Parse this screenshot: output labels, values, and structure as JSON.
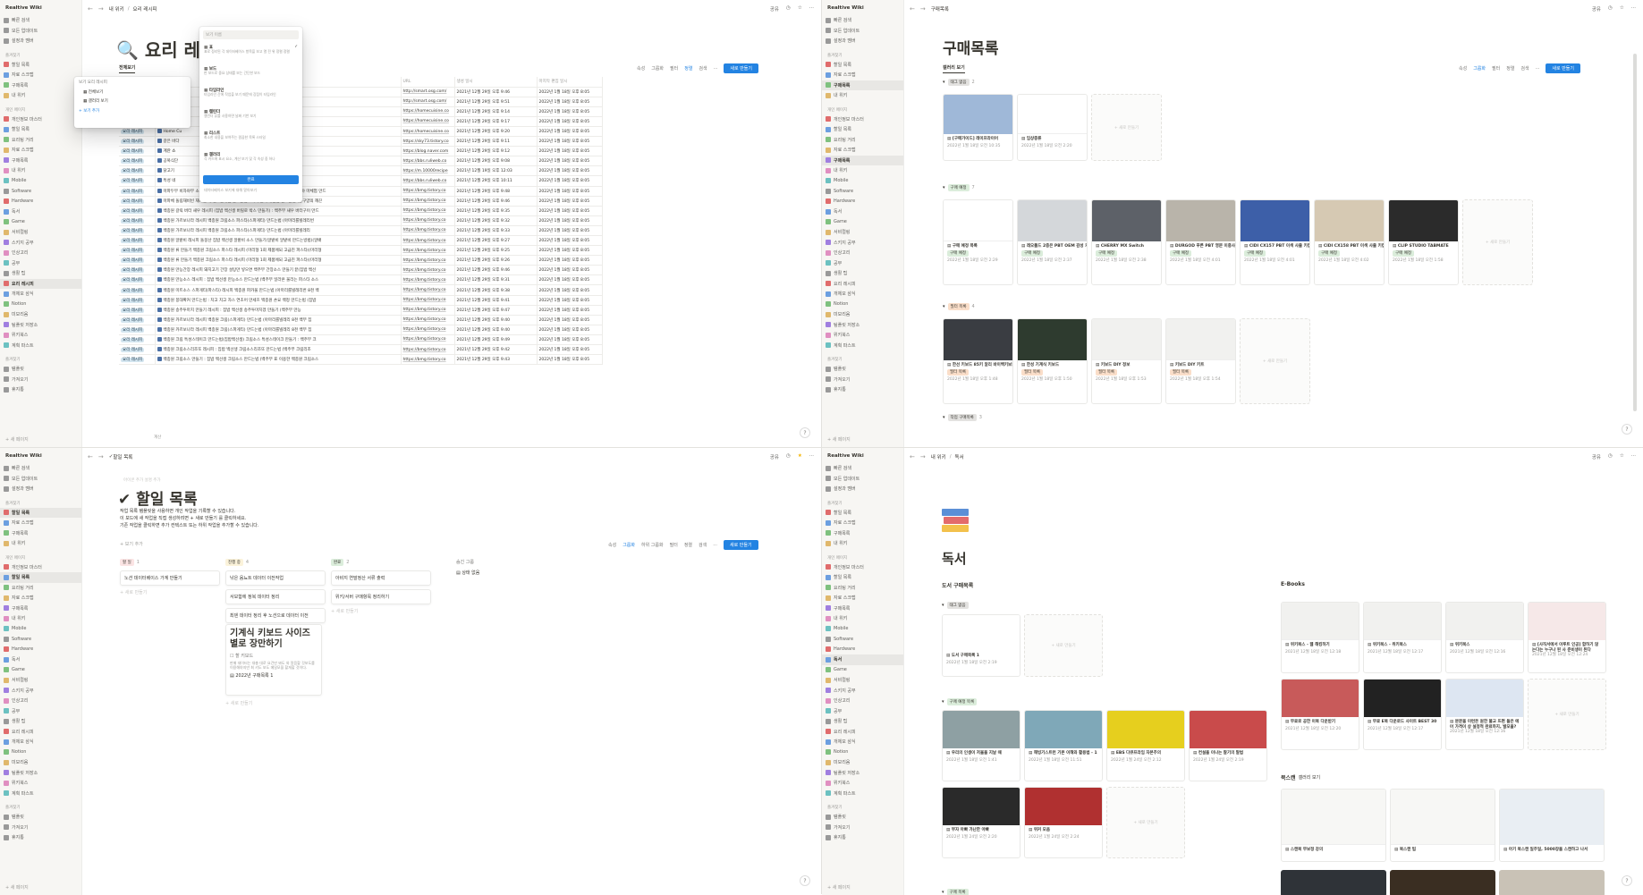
{
  "workspace": "Realtive Wiki",
  "sidebar": {
    "top_items": [
      "빠른 검색",
      "모든 업데이트",
      "설정과 멤버"
    ],
    "favorites_title": "즐겨찾기",
    "favorites": [
      "할일 목록",
      "자료 스크랩",
      "구매목록",
      "내 위키"
    ],
    "private_title": "개인 페이지",
    "private": [
      "개인정보 마스터",
      "할일 목록",
      "요리팅 거리",
      "자료 스크랩",
      "구매목록",
      "내 위키",
      "Mobile",
      "Software",
      "Hardware",
      "독서",
      "Game",
      "서비컬링",
      "스키지 공부",
      "인상고리",
      "공부",
      "생활 팁",
      "요리 레시피",
      "개체모 삼식",
      "Notion",
      "미모리움",
      "팀플릿 저장소",
      "위키북스",
      "계획 파스트"
    ],
    "bottom_items": [
      "템플릿",
      "가져오기",
      "휴지통"
    ],
    "new_page": "+ 새 페이지"
  },
  "q1": {
    "breadcrumb": [
      "내 위키",
      "요리 레시피"
    ],
    "top_right": [
      "공유",
      "◷",
      "☆",
      "···"
    ],
    "title": "요리 레시",
    "view_label": "전체보기",
    "toolbar": [
      "속성",
      "그룹화",
      "필터",
      "정렬",
      "검색",
      "···"
    ],
    "new_button": "새로 만들기",
    "view_popup": {
      "header": "보기 요리 레시피",
      "items": [
        "전체보기",
        "갤러리 보기"
      ],
      "add": "+ 보기 추가"
    },
    "layout_popup": {
      "search": "보기 이름",
      "options": [
        {
          "name": "표",
          "desc": "표로 정리된 각 데이터베이스 항목을 보고 열 전 위 정렬 정렬"
        },
        {
          "name": "보드",
          "desc": "판 보드로 중요 상태를 보는 간단한 보드"
        },
        {
          "name": "타임라인",
          "desc": "타임라인 간에 작업을 보기 때문에 장점이 타임라인"
        },
        {
          "name": "캘린더",
          "desc": "캘린더 뷰를 사용하면 날짜 기반 보기"
        },
        {
          "name": "리스트",
          "desc": "최소한 내용을 보여주는 깔끔한 목록 스타일"
        },
        {
          "name": "갤러리",
          "desc": "각 카드에 표시 요소, 계산 보기 및 각 속성 중 하나"
        }
      ],
      "done": "완료",
      "hint": "데이터베이스 보기에 대해 알아보기"
    },
    "columns": [
      "태그",
      "Aa 이름",
      "URL",
      "생성 일시",
      "마지막 편집 일시"
    ],
    "rows": [
      {
        "tag": "",
        "name": "",
        "url": "http://smart.osg.com/",
        "created": "2021년 12월 29일 오후 9:46",
        "edited": "2022년 1월 18일 오후 8:05"
      },
      {
        "tag": "",
        "name": "",
        "url": "http://smart.osg.com/",
        "created": "2021년 12월 29일 오후 9:51",
        "edited": "2022년 1월 18일 오후 8:05"
      },
      {
        "tag": "",
        "name": "",
        "url": "https://homecuisine.co",
        "created": "2021년 12월 29일 오후 9:14",
        "edited": "2022년 1월 18일 오후 8:05"
      },
      {
        "tag": "요리 레시피",
        "name": "Home Cu",
        "url": "https://homecuisine.co",
        "created": "2021년 12월 29일 오후 9:17",
        "edited": "2022년 1월 18일 오후 8:05"
      },
      {
        "tag": "요리 레시피",
        "name": "Home Cu",
        "url": "https://homecuisine.co",
        "created": "2021년 12월 29일 오후 9:20",
        "edited": "2022년 1월 18일 오후 8:05"
      },
      {
        "tag": "요리 레시피",
        "name": "갈은 바다",
        "url": "https://sky73.tistory.co",
        "created": "2021년 12월 29일 오후 9:11",
        "edited": "2022년 1월 18일 오후 8:05"
      },
      {
        "tag": "요리 레시피",
        "name": "계란 쇼",
        "url": "https://blog.naver.com",
        "created": "2021년 12월 29일 오후 9:12",
        "edited": "2022년 1월 18일 오후 8:05"
      },
      {
        "tag": "요리 레시피",
        "name": "공복식단",
        "url": "https://bbs.ruliweb.co",
        "created": "2021년 12월 29일 오후 9:08",
        "edited": "2022년 1월 18일 오후 8:05"
      },
      {
        "tag": "요리 레시피",
        "name": "닭고기",
        "url": "https://m.10000recipe",
        "created": "2021년 12월 19일 오후 12:03",
        "edited": "2022년 1월 18일 오후 8:05"
      },
      {
        "tag": "요리 레시피",
        "name": "특성 네",
        "url": "https://bbs.ruliweb.co",
        "created": "2021년 12월 29일 오후 10:11",
        "edited": "2022년 1월 18일 오후 8:05"
      },
      {
        "tag": "요리 레시피",
        "name": "마파두부 비자야부 소스 만드는법 - 마파리 를멜레비비 마파두 마소스 파니지 (비자야 마체험 만드",
        "url": "https://bmg.tistory.co",
        "created": "2021년 12월 29일 오후 9:48",
        "edited": "2022년 1월 18일 오후 8:05"
      },
      {
        "tag": "요리 레시피",
        "name": "마파체 돌림재비빈 재비빔 채 일로불볶음 만드는법 : 마파 만화 볶음밥 만드는법 (한구양의 깨끈",
        "url": "https://bmg.tistory.co",
        "created": "2021년 12월 29일 오후 9:46",
        "edited": "2022년 1월 18일 오후 8:05"
      },
      {
        "tag": "요리 레시피",
        "name": "백종원 갈릭 버터 새우 레시피 (집밥 백선생 버릴로 박스 만들기) : 백주부 새우 버터구이 만드",
        "url": "https://bmg.tistory.co",
        "created": "2021년 12월 29일 오후 9:35",
        "edited": "2022년 1월 18일 오후 8:05"
      },
      {
        "tag": "요리 레시피",
        "name": "백종원 가르보나라 레시피 백종원 크림소스 파스타(스파게티) 만드는법 (아마리를빌레리번 ",
        "url": "https://bmg.tistory.co",
        "created": "2021년 12월 29일 오후 9:32",
        "edited": "2022년 1월 18일 오후 8:05"
      },
      {
        "tag": "요리 레시피",
        "name": "백종원 가르보나라 레시피 백종원 크림소스 파스타(스파게티) 만드는법 (아마리를빌레리",
        "url": "https://bmg.tistory.co",
        "created": "2021년 12월 29일 오후 9:33",
        "edited": "2022년 1월 18일 오후 8:05"
      },
      {
        "tag": "요리 레시피",
        "name": "백종원 알밭비 레시피 돌뭉산 집밥 백선생 알밭비 소스 만들기(알밭비 알밭비 만드는방법)(알배",
        "url": "https://bmg.tistory.co",
        "created": "2021년 12월 29일 오후 9:27",
        "edited": "2022년 1월 18일 오후 8:05"
      },
      {
        "tag": "요리 레시피",
        "name": "백종원 류 만들기 백종원 크림소스 파스타 레시피 (마리형 1회 제품에되 고급진 파스타)(마리형",
        "url": "https://bmg.tistory.co",
        "created": "2021년 12월 29일 오후 9:25",
        "edited": "2022년 1월 18일 오후 8:05"
      },
      {
        "tag": "요리 레시피",
        "name": "백종원 류 만들기 백종원 크림소스 파스타 레시피 (마리형 1회 제품에되 고급진 파스타)(마리형",
        "url": "https://bmg.tistory.co",
        "created": "2021년 12월 29일 오후 9:26",
        "edited": "2022년 1월 18일 오후 8:05"
      },
      {
        "tag": "요리 레시피",
        "name": "백종원 만능간장 레시피 돼지고기 간장 설탕만 넣으면 백주부 간장소스 만들기 끝(집밥 백선",
        "url": "https://bmg.tistory.co",
        "created": "2021년 12월 29일 오후 9:46",
        "edited": "2022년 1월 18일 오후 8:05"
      },
      {
        "tag": "요리 레시피",
        "name": "백종원 만능소스 레시피 : 집밥 백선생 만능소스 만드는법 (백주부 일라온 울리는 파스타 소스",
        "url": "https://bmg.tistory.co",
        "created": "2021년 12월 29일 오후 9:31",
        "edited": "2022년 1월 18일 오후 8:05"
      },
      {
        "tag": "요리 레시피",
        "name": "백종원 미트소스 스파게티(파스타) 레시피 백종원 파카울 만드는법 (아마리를빌레리번 8천 백",
        "url": "https://bmg.tistory.co",
        "created": "2021년 12월 29일 오후 9:38",
        "edited": "2022년 1월 18일 오후 8:05"
      },
      {
        "tag": "요리 레시피",
        "name": "백종원 봉대확커 만드는법 : 치고 치고 자스 연초어 만세흐 백종원 손요 백정 만드는법 (집밥",
        "url": "https://bmg.tistory.co",
        "created": "2021년 12월 29일 오후 9:41",
        "edited": "2022년 1월 18일 오후 8:05"
      },
      {
        "tag": "요리 레시피",
        "name": "백종원 송주투마치 만들기 레시피 : 집밥 백선생 송주투마치겠 만들기 (백주부 만능 ",
        "url": "https://bmg.tistory.co",
        "created": "2021년 12월 29일 오후 9:47",
        "edited": "2022년 1월 18일 오후 8:05"
      },
      {
        "tag": "요리 레시피",
        "name": "백종원 카르보나라 레시피 백종원 크림(스파게티) 만드는법 (아마리를빌레리 8천 백부 집",
        "url": "https://bmg.tistory.co",
        "created": "2021년 12월 29일 오후 9:40",
        "edited": "2022년 1월 18일 오후 8:05"
      },
      {
        "tag": "요리 레시피",
        "name": "백종원 카르보나라 레시피 백종원 크림(스파게티) 만드는법 (아마리를빌레리 8천 백부 집",
        "url": "https://bmg.tistory.co",
        "created": "2021년 12월 29일 오후 9:40",
        "edited": "2022년 1월 18일 오후 8:05"
      },
      {
        "tag": "요리 레시피",
        "name": "백종원 크림 특성스테이크 만드는법(집밥백선생) 크림소스 특성스테이크 만들기 : 백주부 크",
        "url": "https://bmg.tistory.co",
        "created": "2021년 12월 29일 오후 9:49",
        "edited": "2022년 1월 18일 오후 8:05"
      },
      {
        "tag": "요리 레시피",
        "name": "백종원 크림소스리조또 레시피 : 집밥 백선생 크림소스리조또 만드는법 (백주부 크림리조",
        "url": "https://bmg.tistory.co",
        "created": "2021년 12월 29일 오후 9:42",
        "edited": "2022년 1월 18일 오후 8:05"
      },
      {
        "tag": "요리 레시피",
        "name": "백종원 크림소스 만들기 : 집밥 백선생 크림소스 만드는법 (백주부 표 이용한 백종원 크림소스",
        "url": "https://bmg.tistory.co",
        "created": "2021년 12월 29일 오후 9:43",
        "edited": "2022년 1월 18일 오후 8:05"
      }
    ],
    "footer_calc": "계산"
  },
  "q2": {
    "breadcrumb": [
      "구매목록"
    ],
    "title": "구매목록",
    "view_label": "갤러리 보기",
    "toolbar": [
      "속성",
      "그룹화",
      "필터",
      "정렬",
      "검색",
      "···"
    ],
    "new_button": "새로 만들기",
    "groups": [
      {
        "label": "태그 없음",
        "color": "#e3e2e0",
        "count": "2",
        "cards": [
          {
            "title": "[구매가이드] 레이프라이어",
            "date": "2022년 1월 18일 오전 10:35",
            "cover": "#9fb8d8",
            "tag": ""
          },
          {
            "title": "임상종류",
            "date": "2022년 1월 18일 오전 2:20",
            "cover": "#ffffff",
            "tag": ""
          }
        ]
      },
      {
        "label": "구매 예정",
        "color": "#dbeddb",
        "count": "7",
        "cards": [
          {
            "title": "구매 예정 목록",
            "date": "2022년 1월 18일 오전 2:29",
            "cover": "#ffffff",
            "tag": "구매 예정"
          },
          {
            "title": "레오폴드 2층은 PBT OEM 감성 키캡",
            "date": "2022년 1월 18일 오전 2:37",
            "cover": "#d4d7da",
            "tag": "구매 예정"
          },
          {
            "title": "CHERRY MX Switch",
            "date": "2022년 1월 18일 오전 2:38",
            "cover": "#5d6168",
            "tag": "구매 예정"
          },
          {
            "title": "DURGOD 푸른 PBT 영문 이중사출 GR 키캡",
            "date": "2022년 1월 18일 오전 4:01",
            "cover": "#b9b4aa",
            "tag": "구매 예정"
          },
          {
            "title": "CIDI CX157 PBT 이색 사출 키캡 토레이 세트(Blue Tang)",
            "date": "2022년 1월 18일 오전 4:01",
            "cover": "#3d5fa8",
            "tag": "구매 예정"
          },
          {
            "title": "CIDI CX158 PBT 이색 사출 키캡 토레이 세트(Ocelam)",
            "date": "2022년 1월 18일 오전 4:02",
            "cover": "#d6c9b3",
            "tag": "구매 예정"
          },
          {
            "title": "CLIP STUDIO TABMATE",
            "date": "2022년 1월 18일 오전 1:58",
            "cover": "#2b2b2b",
            "tag": "구매 예정"
          }
        ]
      },
      {
        "label": "필터 목록",
        "color": "#fadec9",
        "count": "4",
        "cards": [
          {
            "title": "한선 키보드 85키 알리 바이백키보드",
            "date": "2022년 1월 18일 오후 1:48",
            "cover": "#3a3d42",
            "tag": "필터 목록"
          },
          {
            "title": "한성 기계식 키보드",
            "date": "2022년 1월 18일 오후 1:50",
            "cover": "#2e3b2f",
            "tag": "필터 목록"
          },
          {
            "title": "키보드 DIY 정보",
            "date": "2022년 1월 18일 오후 1:53",
            "cover": "#f1f1ef",
            "tag": "필터 목록"
          },
          {
            "title": "키보드 DIY 키트",
            "date": "2022년 1월 18일 오후 1:54",
            "cover": "#f1f1ef",
            "tag": "필터 목록"
          }
        ]
      },
      {
        "label": "작업 구매목록",
        "color": "#e3e2e0",
        "count": "3",
        "cards": []
      }
    ],
    "add_card": "+ 새로 만들기"
  },
  "q3": {
    "breadcrumb": [
      "할일 목록"
    ],
    "top_right": [
      "공유",
      "◷",
      "★",
      "···"
    ],
    "icon_hint": "아이콘 추가  설명 추가",
    "title": "할일 목록",
    "desc": [
      "작업 목록 템플릿을 사용하면 개인 작업을 기록할 수 있습니다.",
      "이 보드에 새 작업을 직접 생성하려면 + 새로 만들기 를 클릭하세요.",
      "기존 작업을 클릭하면 추가 컨텍스트 또는 하위 작업을 추가할 수 있습니다."
    ],
    "add_view": "+ 보기 추가",
    "toolbar": [
      "속성",
      "그룹화",
      "하위 그룹화",
      "필터",
      "정렬",
      "검색",
      "···"
    ],
    "new_button": "새로 만들기",
    "columns": [
      {
        "label": "할 일",
        "color": "#fbe4e4",
        "count": "1",
        "cards": [
          "노션 데이터베이스 가계 만들기"
        ]
      },
      {
        "label": "진행 중",
        "color": "#fbf3db",
        "count": "4",
        "cards": [
          "낚은 음뇨트 데이터 이전작업",
          "서보함에 정복 데이터 정리",
          "최덴 데이터 정리 후 노션으로 데이터 이전"
        ]
      },
      {
        "label": "완료",
        "color": "#dbeddb",
        "count": "2",
        "cards": [
          "아비지 연말정산 서류 출력",
          "위키/서버 구매항목 정리하기"
        ]
      }
    ],
    "hidden_title": "숨긴 그룹",
    "hidden_item": "상태 없음",
    "featured": {
      "title": "기계식 키보드 사이즈 별로 장만하기",
      "check": "할 키보드",
      "body": "판매 데이터는 대충 대로 요건만 봐도 와 알음할 것보도를 이용해야지만 최 키도 보도 메일모을 할게할 것이다.",
      "link": "2022년 구매목록 1"
    },
    "add_card": "+ 새로 만들기"
  },
  "q4": {
    "breadcrumb": [
      "내 위키",
      "독서"
    ],
    "top_right": [
      "공유",
      "◷",
      "☆",
      "···"
    ],
    "title": "독서",
    "left_section": "도서 구매목록",
    "right_section": "E-Books",
    "group1_label": "태그 없음",
    "group1_cards": [
      {
        "title": "도서 구매목록 1",
        "date": "2022년 1월 18일 오전 2:19"
      }
    ],
    "group2_label": "구매 예정 목록",
    "group2_cards": [
      {
        "title": "우리의 인생이 저울을 지날 때",
        "date": "2022년 1월 18일 오전 1:41",
        "cover": "#8ea0a3"
      },
      {
        "title": "해빙기스트런 기본 이해와 활용법 - 1",
        "date": "2022년 1월 18일 오전 11:51",
        "cover": "#7fa8b8"
      },
      {
        "title": "EBS 다큐프라임 자본주의",
        "date": "2022년 1월 24일 오전 2:12",
        "cover": "#e6cf1e"
      },
      {
        "title": "컨설을 이나는 잘기의 말법",
        "date": "2022년 1월 24일 오전 2:19",
        "cover": "#c94b4b"
      },
      {
        "title": "부자 아빠 가난한 아빠",
        "date": "2022년 1월 24일 오전 2:20",
        "cover": "#2a2a2a"
      },
      {
        "title": "위커 모음",
        "date": "2022년 1월 24일 오전 2:24",
        "cover": "#b03030"
      }
    ],
    "ebooks": [
      {
        "title": "위키북스 - 웹 해킹하기",
        "date": "2021년 12월 18일 오전 12:18",
        "cover": "#f1f1ef"
      },
      {
        "title": "위키북스 - 위키북스",
        "date": "2021년 12월 18일 오전 12:17",
        "cover": "#f1f1ef"
      },
      {
        "title": "위키북스",
        "date": "2021년 12월 18일 오전 12:16",
        "cover": "#f1f1ef"
      },
      {
        "title": "[사직서에서 이루트 인공] 합하기 않는다는 누구나 된 사 준비생이 된다",
        "date": "2021년 12월 18일 오전 12:24",
        "cover": "#f6e8e8"
      },
      {
        "title": "무료로 공한 이북 다운받기",
        "date": "2021년 12월 18일 오전 12:20",
        "cover": "#c85a5a"
      },
      {
        "title": "무료 E북 다운로드 사이트 BEST 30",
        "date": "2021년 12월 18일 오전 12:17",
        "cover": "#222222"
      },
      {
        "title": "분문을 이런돈 원한 불교 뜨편 들은 에어 가격이 상 설정적 완료하지, 발모을?",
        "date": "2021년 12월 18일 오전 12:16",
        "cover": "#dde6f2"
      }
    ],
    "bookstore_title": "북스캔",
    "bookstore_view": "갤러리 보기",
    "bookstore_cards": [
      {
        "title": "스캔북 무보정 강의",
        "cover": "#f7f7f5"
      },
      {
        "title": "북스캔 팁",
        "cover": "#f7f7f5"
      },
      {
        "title": "아기 북스캔 일주일, 5000장을 스캔하고 나서",
        "cover": "#e9eef3"
      }
    ],
    "bottom_group": "구매 목록",
    "add_card": "+ 새로 만들기"
  }
}
